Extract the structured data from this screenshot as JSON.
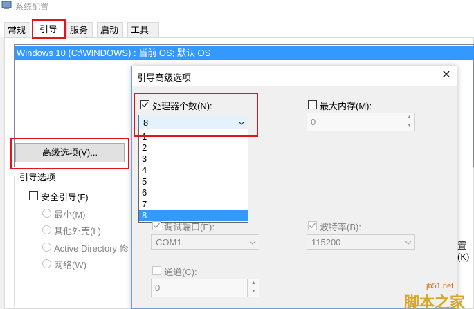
{
  "window": {
    "title": "系统配置",
    "tabs": [
      "常规",
      "引导",
      "服务",
      "启动",
      "工具"
    ],
    "active_tab": "引导",
    "os_entry": "Windows 10 (C:\\WINDOWS) : 当前 OS; 默认 OS",
    "advanced_button": "高级选项(V)...",
    "boot_options_group": "引导选项",
    "safe_boot": "安全引导(F)",
    "radio_minimal": "最小(M)",
    "radio_alternate_shell": "其他外壳(L)",
    "radio_active_directory": "Active Directory 修",
    "radio_network": "网络(W)",
    "partial_right_label": "置(K)"
  },
  "dialog": {
    "title": "引导高级选项",
    "close_glyph": "✕",
    "num_processors_label": "处理器个数(N):",
    "num_processors_checked": true,
    "num_processors_value": "8",
    "processor_options": [
      "1",
      "2",
      "3",
      "4",
      "5",
      "6",
      "7",
      "8"
    ],
    "max_memory_label": "最大内存(M):",
    "max_memory_checked": false,
    "max_memory_value": "0",
    "debug_port_label": "调试端口(E):",
    "debug_port_value": "COM1:",
    "baud_rate_label": "波特率(B):",
    "baud_rate_value": "115200",
    "channel_label": "通道(C):",
    "channel_value": "0"
  },
  "watermark": {
    "site": "jb51.net",
    "name": "脚本之家"
  },
  "colors": {
    "highlight_red": "#e0161f",
    "selection_blue": "#3399ff",
    "watermark_orange": "#e06b16"
  }
}
